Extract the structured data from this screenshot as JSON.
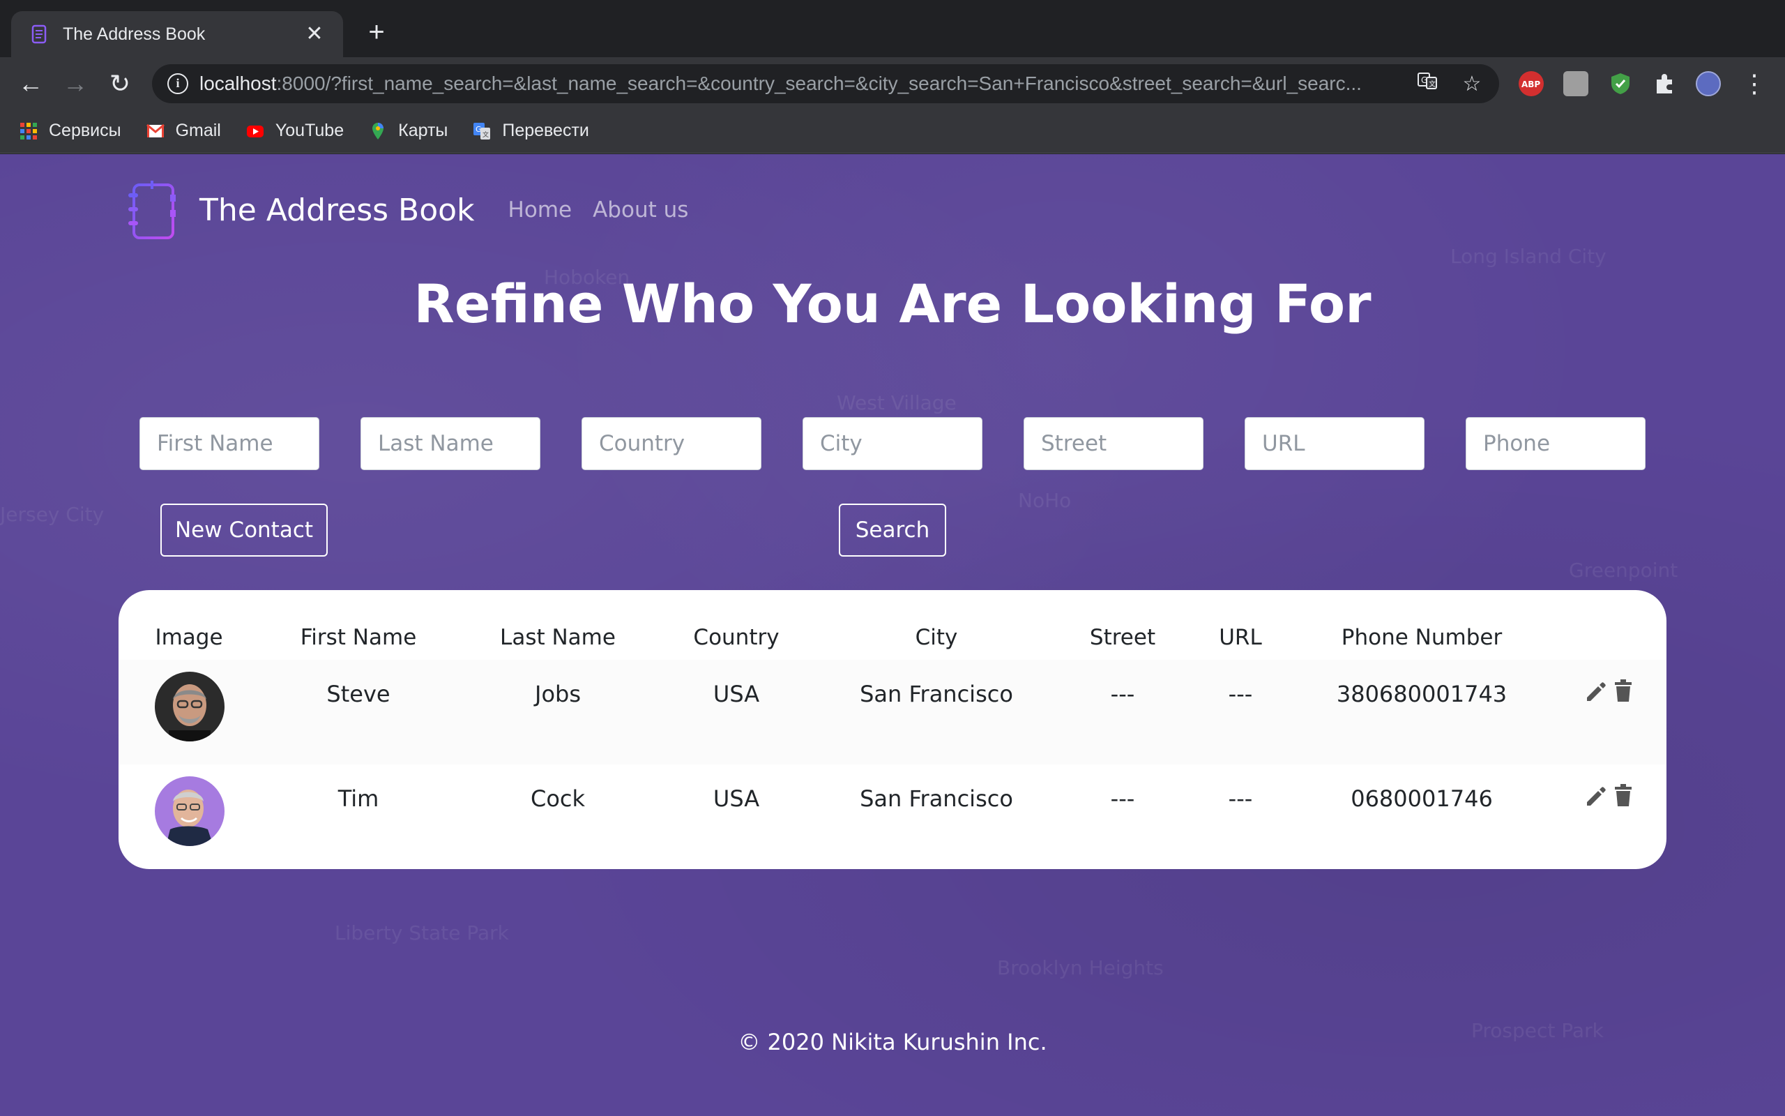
{
  "browser": {
    "tab_title": "The Address Book",
    "url_host": "localhost",
    "url_rest": ":8000/?first_name_search=&last_name_search=&country_search=&city_search=San+Francisco&street_search=&url_searc...",
    "bookmarks": [
      {
        "icon": "apps-grid-icon",
        "label": "Сервисы"
      },
      {
        "icon": "gmail-icon",
        "label": "Gmail"
      },
      {
        "icon": "youtube-icon",
        "label": "YouTube"
      },
      {
        "icon": "maps-icon",
        "label": "Карты"
      },
      {
        "icon": "translate-icon",
        "label": "Перевести"
      }
    ],
    "extensions": [
      "adblock-icon",
      "touch-extension-icon",
      "shield-extension-icon",
      "puzzle-icon",
      "profile-avatar-icon"
    ]
  },
  "nav": {
    "brand": "The Address Book",
    "links": [
      "Home",
      "About us"
    ]
  },
  "headline": "Refine Who You Are Looking For",
  "search": {
    "placeholders": [
      "First Name",
      "Last Name",
      "Country",
      "City",
      "Street",
      "URL",
      "Phone"
    ],
    "new_contact_label": "New Contact",
    "search_label": "Search"
  },
  "table": {
    "headers": [
      "Image",
      "First Name",
      "Last Name",
      "Country",
      "City",
      "Street",
      "URL",
      "Phone Number"
    ],
    "rows": [
      {
        "first_name": "Steve",
        "last_name": "Jobs",
        "country": "USA",
        "city": "San Francisco",
        "street": "---",
        "url": "---",
        "phone": "380680001743"
      },
      {
        "first_name": "Tim",
        "last_name": "Cock",
        "country": "USA",
        "city": "San Francisco",
        "street": "---",
        "url": "---",
        "phone": "0680001746"
      }
    ]
  },
  "footer": "© 2020 Nikita Kurushin Inc.",
  "colors": {
    "page_background": "#5a4597",
    "logo_accent": "#8b5cf6",
    "card_background": "#ffffff",
    "chrome_dark": "#202124",
    "chrome_toolbar": "#35363a"
  }
}
